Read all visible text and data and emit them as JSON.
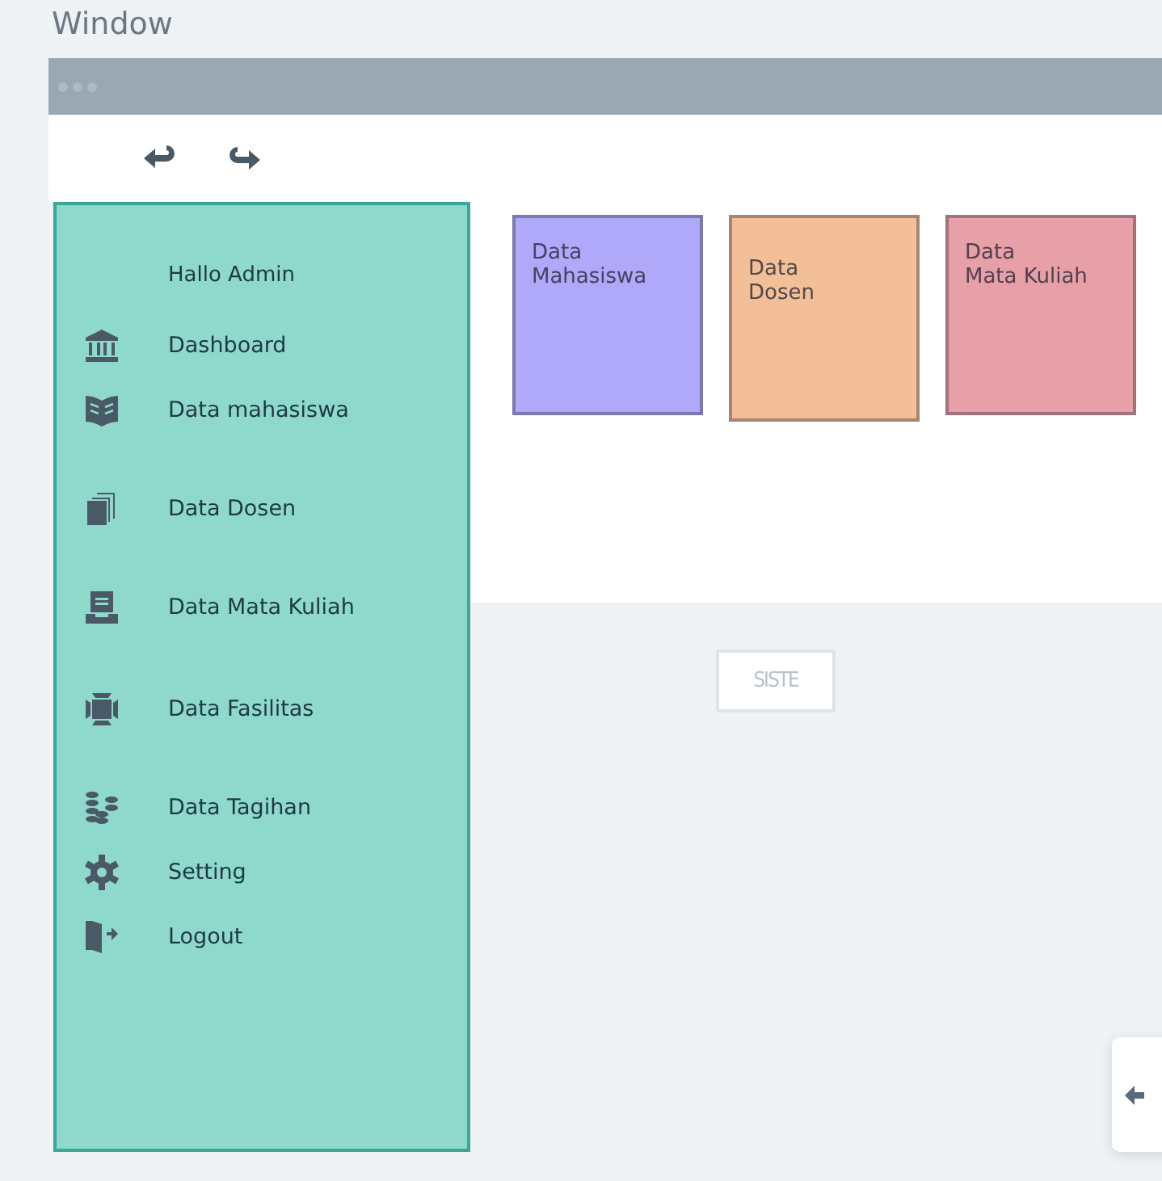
{
  "window": {
    "title": "Window"
  },
  "toolbar": [
    {
      "kind": "undo"
    },
    {
      "kind": "redo"
    }
  ],
  "sidebar": {
    "greeting": "Hallo Admin",
    "items": [
      {
        "kind": "bank",
        "label": "Dashboard"
      },
      {
        "kind": "book",
        "label": "Data mahasiswa"
      },
      {
        "kind": "copy",
        "label": "Data Dosen"
      },
      {
        "kind": "inbox",
        "label": "Data Mata Kuliah"
      },
      {
        "kind": "chip",
        "label": "Data Fasilitas"
      },
      {
        "kind": "coins",
        "label": "Data Tagihan"
      },
      {
        "kind": "gear",
        "label": "Setting"
      },
      {
        "kind": "door",
        "label": "Logout"
      }
    ]
  },
  "cards": [
    {
      "title": "Data\nMahasiswa",
      "color": "#b0a8f8"
    },
    {
      "title": "Data\nDosen",
      "color": "#f2bf98"
    },
    {
      "title": "Data\nMata Kuliah",
      "color": "#e8a0a8"
    }
  ],
  "button": {
    "label": "SISTE"
  },
  "corner_card": {
    "kind": "back"
  }
}
